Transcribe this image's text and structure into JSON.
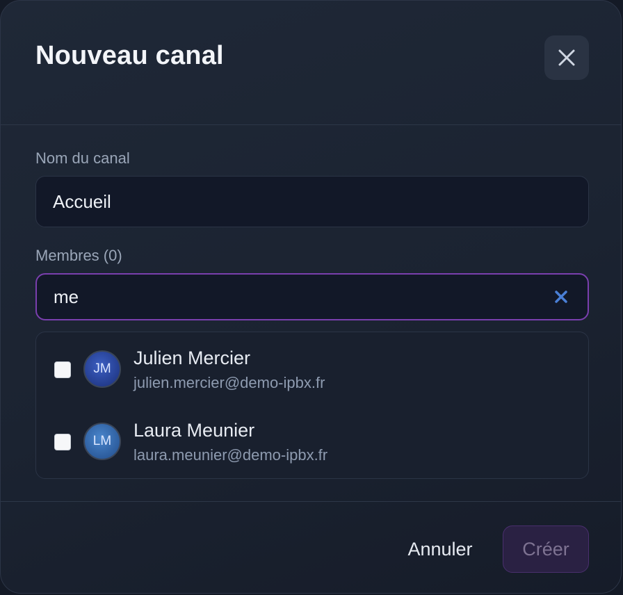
{
  "dialog": {
    "title": "Nouveau canal",
    "close_icon": "close-icon"
  },
  "form": {
    "name_label": "Nom du canal",
    "name_value": "Accueil",
    "members_label": "Membres (0)",
    "search_value": "me",
    "clear_icon": "clear-x-icon"
  },
  "results": [
    {
      "initials": "JM",
      "name": "Julien Mercier",
      "email": "julien.mercier@demo-ipbx.fr",
      "checked": false
    },
    {
      "initials": "LM",
      "name": "Laura Meunier",
      "email": "laura.meunier@demo-ipbx.fr",
      "checked": false
    }
  ],
  "footer": {
    "cancel_label": "Annuler",
    "create_label": "Créer",
    "create_disabled": true
  },
  "colors": {
    "accent": "#7a3fae",
    "clear_icon": "#4a7fd6",
    "background": "#1b2331"
  }
}
